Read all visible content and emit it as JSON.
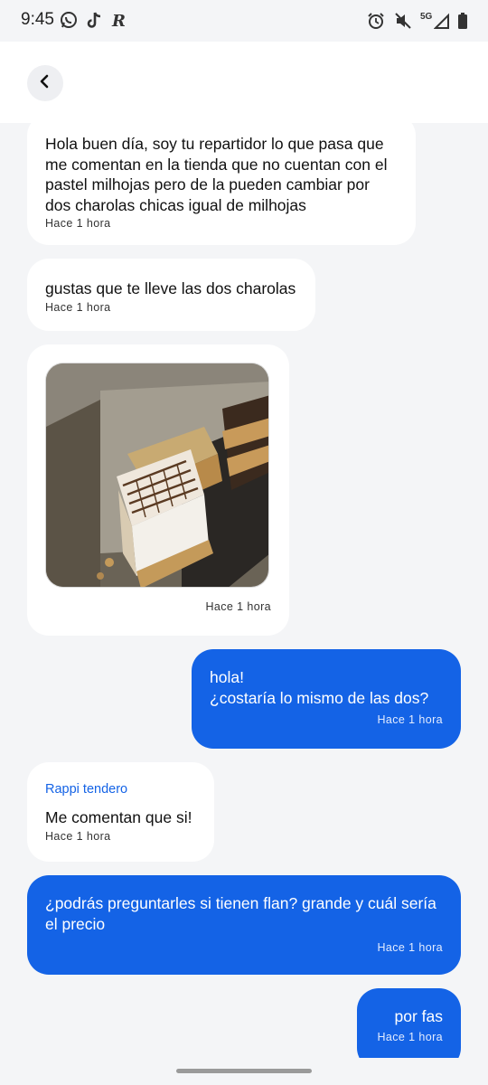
{
  "status_bar": {
    "time": "9:45",
    "network": "5G",
    "left_icons": [
      "whatsapp-icon",
      "tiktok-icon",
      "rappi-icon"
    ],
    "right_icons": [
      "alarm-icon",
      "mute-icon",
      "signal-icon",
      "battery-icon"
    ]
  },
  "header": {
    "back_icon": "chevron-left-icon"
  },
  "messages": [
    {
      "direction": "incoming",
      "text": "Hola buen día, soy tu repartidor lo que pasa que me comentan en la tienda que no cuentan con el pastel milhojas pero de la pueden cambiar por dos charolas chicas igual de milhojas",
      "time": "Hace 1 hora"
    },
    {
      "direction": "incoming",
      "text": "gustas que te lleve las dos charolas",
      "time": "Hace 1 hora"
    },
    {
      "direction": "incoming",
      "type": "image",
      "image_alt": "photo of milhojas cake slices in a tray",
      "time": "Hace 1 hora"
    },
    {
      "direction": "outgoing",
      "text": "hola!\n¿costaría lo mismo de las dos?",
      "time": "Hace 1 hora"
    },
    {
      "direction": "incoming",
      "sender": "Rappi tendero",
      "text": "Me comentan que si!",
      "time": "Hace 1 hora"
    },
    {
      "direction": "outgoing",
      "text": "¿podrás preguntarles si tienen flan? grande y cuál sería el precio",
      "time": "Hace 1 hora"
    },
    {
      "direction": "outgoing",
      "text": "por fas",
      "time": "Hace 1 hora"
    }
  ],
  "colors": {
    "outgoing_bubble": "#1463e6",
    "incoming_bubble": "#ffffff",
    "background": "#f4f5f7",
    "sender_name": "#1463e6"
  }
}
